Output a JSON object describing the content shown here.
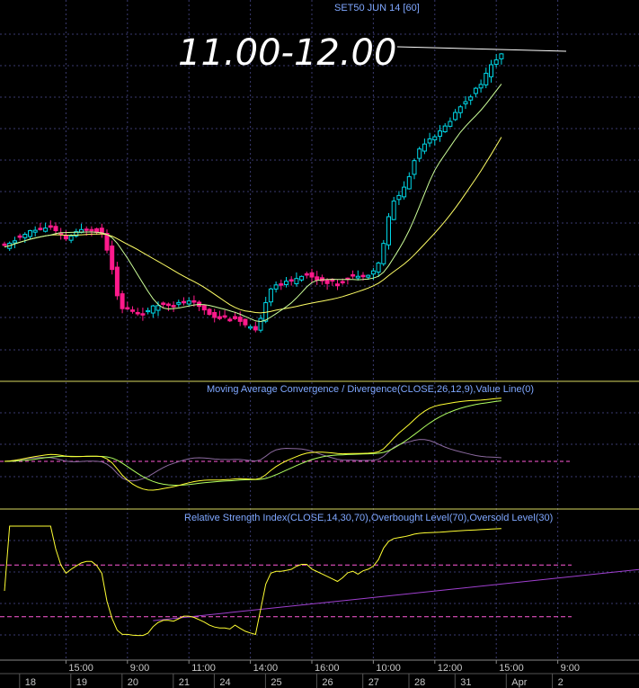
{
  "window": {
    "title": "SET50 JUN 14  [60]"
  },
  "annotation": {
    "text": "11.00-12.00"
  },
  "colors": {
    "background": "#000000",
    "grid": "#3a3a70",
    "up_candle": "#00d8e8",
    "down_candle": "#ff1a8c",
    "ma_fast": "#ffff66",
    "ma_slow": "#ccff99",
    "macd_line": "#ffff33",
    "macd_signal": "#b0ff60",
    "macd_hist": "#8c6aa0",
    "rsi_line": "#ffff33",
    "level_lines": "#ff5ad8",
    "trendline": "#a040d0",
    "separator": "#d8d860",
    "panel_text": "#7fa7ff"
  },
  "panels": {
    "macd_label": "Moving Average Convergence / Divergence(CLOSE,26,12,9),Value Line(0)",
    "rsi_label": "Relative Strength Index(CLOSE,14,30,70),Overbought Level(70),Oversold Level(30)"
  },
  "axis": {
    "time_ticks": [
      {
        "label": "15:00",
        "bar": 12
      },
      {
        "label": "9:00",
        "bar": 24
      },
      {
        "label": "11:00",
        "bar": 36
      },
      {
        "label": "14:00",
        "bar": 48
      },
      {
        "label": "16:00",
        "bar": 60
      },
      {
        "label": "10:00",
        "bar": 72
      },
      {
        "label": "12:00",
        "bar": 84
      },
      {
        "label": "15:00",
        "bar": 96
      },
      {
        "label": "9:00",
        "bar": 108
      }
    ],
    "date_ticks": [
      {
        "label": "18",
        "bar": 4
      },
      {
        "label": "19",
        "bar": 14
      },
      {
        "label": "20",
        "bar": 24
      },
      {
        "label": "21",
        "bar": 34
      },
      {
        "label": "24",
        "bar": 42
      },
      {
        "label": "25",
        "bar": 52
      },
      {
        "label": "26",
        "bar": 62
      },
      {
        "label": "27",
        "bar": 71
      },
      {
        "label": "28",
        "bar": 80
      },
      {
        "label": "31",
        "bar": 89
      },
      {
        "label": "Apr",
        "bar": 99
      },
      {
        "label": "2",
        "bar": 108
      }
    ]
  },
  "chart_data": {
    "type": "candlestick",
    "closes": [
      197,
      199,
      202,
      204,
      206,
      208,
      209,
      210,
      211,
      211,
      208,
      205,
      203,
      205,
      207,
      209,
      210,
      210,
      209,
      207,
      196,
      182,
      163,
      152,
      152,
      150,
      149,
      149,
      150,
      153,
      155,
      156,
      156,
      155,
      156,
      157,
      157,
      156,
      154,
      152,
      149,
      147,
      146,
      146,
      145,
      146,
      143,
      140,
      138,
      136,
      144,
      158,
      168,
      170,
      170,
      171,
      172,
      175,
      177,
      177,
      175,
      174,
      173,
      172,
      171,
      170,
      172,
      175,
      176,
      175,
      177,
      178,
      180,
      185,
      200,
      218,
      230,
      235,
      240,
      248,
      260,
      268,
      273,
      276,
      278,
      280,
      284,
      289,
      294,
      299,
      303,
      307,
      311,
      316,
      322,
      328,
      333,
      337
    ],
    "rsi_trendline": {
      "from": {
        "bar": 29,
        "value": 27
      },
      "to": {
        "bar": 125,
        "value": 67
      }
    },
    "rsi_levels": {
      "overbought": 70,
      "oversold": 30
    },
    "macd_zero_line": 0,
    "ma_periods": [
      10,
      25
    ]
  }
}
